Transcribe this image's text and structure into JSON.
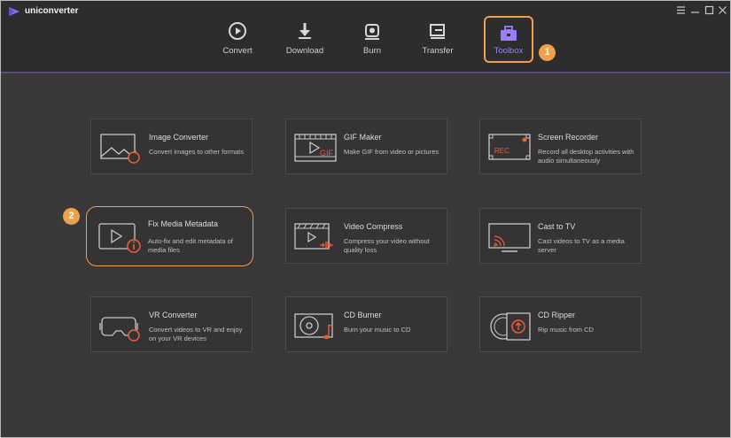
{
  "app": {
    "name": "uniconverter"
  },
  "window_controls": [
    "menu-icon",
    "minimize-icon",
    "maximize-icon",
    "close-icon"
  ],
  "nav": [
    {
      "label": "Convert",
      "icon": "convert-icon"
    },
    {
      "label": "Download",
      "icon": "download-icon"
    },
    {
      "label": "Burn",
      "icon": "burn-icon"
    },
    {
      "label": "Transfer",
      "icon": "transfer-icon"
    },
    {
      "label": "Toolbox",
      "icon": "toolbox-icon",
      "active": true
    }
  ],
  "callouts": [
    "1",
    "2"
  ],
  "tools": [
    {
      "title": "Image Converter",
      "desc": "Convert images to other formats",
      "icon": "image-converter-icon"
    },
    {
      "title": "GIF Maker",
      "desc": "Make GIF from video or pictures",
      "icon": "gif-maker-icon",
      "badge": "GIF"
    },
    {
      "title": "Screen Recorder",
      "desc": "Record all desktop activities with audio simultaneously",
      "icon": "screen-recorder-icon",
      "badge": "REC"
    },
    {
      "title": "Fix Media Metadata",
      "desc": "Auto-fix and edit metadata of media files",
      "icon": "fix-metadata-icon"
    },
    {
      "title": "Video Compress",
      "desc": "Compress your video without quality loss",
      "icon": "video-compress-icon"
    },
    {
      "title": "Cast to TV",
      "desc": "Cast videos to TV as a media server",
      "icon": "cast-tv-icon"
    },
    {
      "title": "VR Converter",
      "desc": "Convert videos to VR and enjoy on your VR devices",
      "icon": "vr-converter-icon"
    },
    {
      "title": "CD Burner",
      "desc": "Burn your music to CD",
      "icon": "cd-burner-icon"
    },
    {
      "title": "CD Ripper",
      "desc": "Rip music from CD",
      "icon": "cd-ripper-icon"
    }
  ],
  "colors": {
    "accent_orange": "#f0a04b",
    "active_purple": "#9d7cff",
    "background": "#3a3838",
    "header": "#2e2d2d",
    "card": "#353333"
  }
}
